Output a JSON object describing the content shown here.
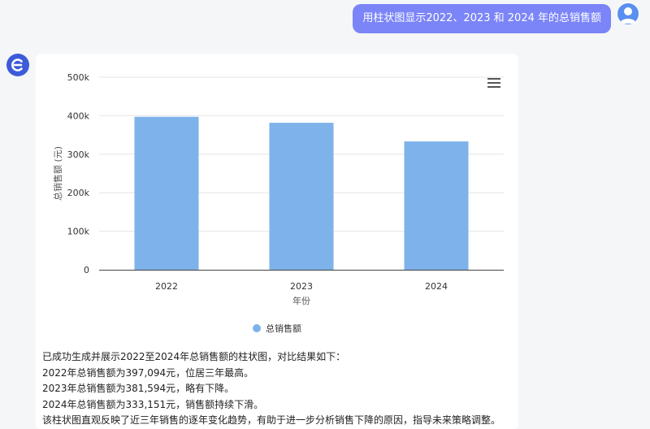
{
  "user_message": "用柱状图显示2022、2023 和 2024 年的总销售额",
  "chart_data": {
    "type": "bar",
    "categories": [
      "2022",
      "2023",
      "2024"
    ],
    "series": [
      {
        "name": "总销售额",
        "values": [
          397094,
          381594,
          333151
        ]
      }
    ],
    "y_ticks": [
      "0",
      "100k",
      "200k",
      "300k",
      "400k",
      "500k"
    ],
    "ylim": [
      0,
      500000
    ],
    "xlabel": "年份",
    "ylabel": "总销售额 (元)",
    "bar_color": "#7eb2ea",
    "legend_position": "bottom"
  },
  "answer": {
    "lines": [
      "已成功生成并展示2022至2024年总销售额的柱状图，对比结果如下：",
      "2022年总销售额为397,094元，位居三年最高。",
      "2023年总销售额为381,594元，略有下降。",
      "2024年总销售额为333,151元，销售额持续下滑。",
      "该柱状图直观反映了近三年销售的逐年变化趋势，有助于进一步分析销售下降的原因，指导未来策略调整。"
    ]
  },
  "icons": {
    "user_avatar": "user-avatar-icon",
    "bot_avatar": "bot-logo-icon",
    "chart_menu": "hamburger-menu-icon"
  }
}
